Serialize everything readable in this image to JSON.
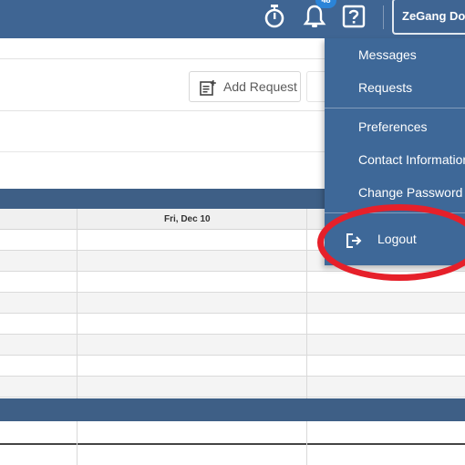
{
  "header": {
    "timer_icon": "stopwatch-icon",
    "notifications_icon": "bell-icon",
    "notification_count": "48",
    "help_icon": "question-icon",
    "user_name": "ZeGang Do"
  },
  "toolbar": {
    "add_request_label": "Add Request",
    "add_request_icon": "add-note-icon"
  },
  "calendar": {
    "day_header": "Fri, Dec 10"
  },
  "user_menu": {
    "items": [
      {
        "label": "Messages"
      },
      {
        "label": "Requests"
      },
      {
        "label": "Preferences"
      },
      {
        "label": "Contact Information"
      },
      {
        "label": "Change Password"
      }
    ],
    "logout_label": "Logout",
    "logout_icon": "logout-icon"
  },
  "colors": {
    "header_bg": "#3f6593",
    "menu_bg": "#3e6898",
    "annotation": "#e6202a"
  }
}
